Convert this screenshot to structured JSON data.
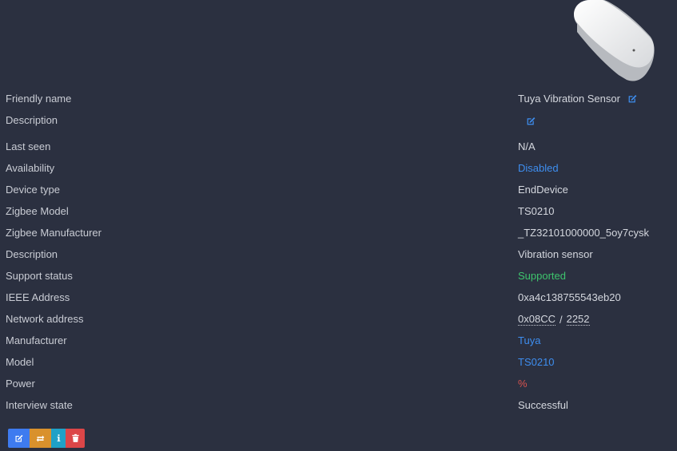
{
  "device": {
    "image_name": "tuya-vibration-sensor-image"
  },
  "rows": [
    {
      "label": "Friendly name",
      "value": "Tuya Vibration Sensor"
    },
    {
      "label": "Description",
      "value": ""
    },
    {
      "label": "Last seen",
      "value": "N/A"
    },
    {
      "label": "Availability",
      "value": "Disabled"
    },
    {
      "label": "Device type",
      "value": "EndDevice"
    },
    {
      "label": "Zigbee Model",
      "value": "TS0210"
    },
    {
      "label": "Zigbee Manufacturer",
      "value": "_TZ32101000000_5oy7cysk"
    },
    {
      "label": "Description",
      "value": "Vibration sensor"
    },
    {
      "label": "Support status",
      "value": "Supported"
    },
    {
      "label": "IEEE Address",
      "value": "0xa4c138755543eb20"
    },
    {
      "label": "Network address",
      "value_hex": "0x08CC",
      "value_sep": "/",
      "value_dec": "2252"
    },
    {
      "label": "Manufacturer",
      "value": "Tuya"
    },
    {
      "label": "Model",
      "value": "TS0210"
    },
    {
      "label": "Power",
      "value": "%"
    },
    {
      "label": "Interview state",
      "value": "Successful"
    }
  ],
  "icons": {
    "edit": "edit-icon",
    "reconfigure": "reconfigure-icon",
    "info": "info-icon",
    "remove": "trash-icon"
  },
  "colors": {
    "background": "#2b3040",
    "link": "#3e8ef0",
    "supported": "#3ec46d",
    "power": "#d9534f",
    "edit_button": "#3e7bf0",
    "reconfigure_button": "#d9912c",
    "info_button": "#1fa1c7",
    "remove_button": "#dc4648"
  }
}
